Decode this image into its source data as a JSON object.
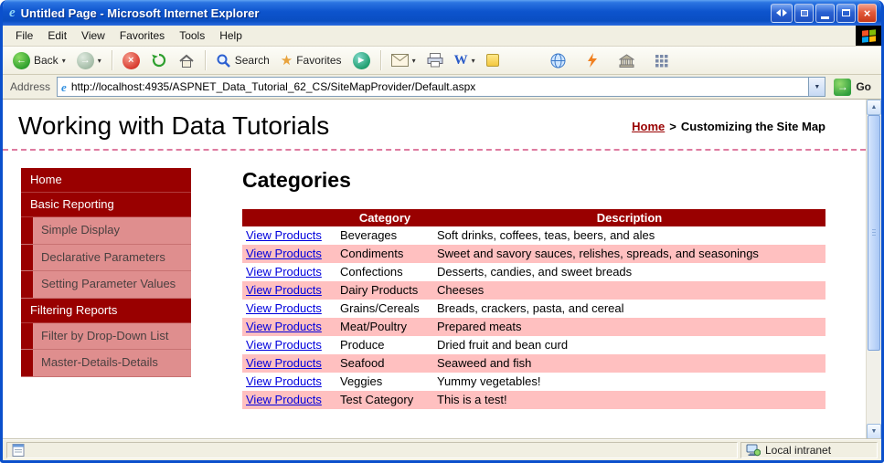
{
  "window": {
    "title": "Untitled Page - Microsoft Internet Explorer",
    "menu": [
      "File",
      "Edit",
      "View",
      "Favorites",
      "Tools",
      "Help"
    ],
    "toolbar": {
      "back": "Back",
      "search": "Search",
      "favorites": "Favorites"
    },
    "address": {
      "label": "Address",
      "url": "http://localhost:4935/ASPNET_Data_Tutorial_62_CS/SiteMapProvider/Default.aspx",
      "go": "Go"
    },
    "status": {
      "zone": "Local intranet"
    }
  },
  "page": {
    "header": {
      "title": "Working with Data Tutorials",
      "breadcrumb": {
        "home": "Home",
        "separator": ">",
        "current": "Customizing the Site Map"
      }
    },
    "sidebar": {
      "items": [
        {
          "label": "Home",
          "level": 1
        },
        {
          "label": "Basic Reporting",
          "level": 1
        },
        {
          "label": "Simple Display",
          "level": 2
        },
        {
          "label": "Declarative Parameters",
          "level": 2
        },
        {
          "label": "Setting Parameter Values",
          "level": 2
        },
        {
          "label": "Filtering Reports",
          "level": 1
        },
        {
          "label": "Filter by Drop-Down List",
          "level": 2
        },
        {
          "label": "Master-Details-Details",
          "level": 2
        }
      ]
    },
    "main": {
      "heading": "Categories",
      "table": {
        "headers": [
          "",
          "Category",
          "Description"
        ],
        "link_label": "View Products",
        "rows": [
          {
            "category": "Beverages",
            "description": "Soft drinks, coffees, teas, beers, and ales"
          },
          {
            "category": "Condiments",
            "description": "Sweet and savory sauces, relishes, spreads, and seasonings"
          },
          {
            "category": "Confections",
            "description": "Desserts, candies, and sweet breads"
          },
          {
            "category": "Dairy Products",
            "description": "Cheeses"
          },
          {
            "category": "Grains/Cereals",
            "description": "Breads, crackers, pasta, and cereal"
          },
          {
            "category": "Meat/Poultry",
            "description": "Prepared meats"
          },
          {
            "category": "Produce",
            "description": "Dried fruit and bean curd"
          },
          {
            "category": "Seafood",
            "description": "Seaweed and fish"
          },
          {
            "category": "Veggies",
            "description": "Yummy vegetables!"
          },
          {
            "category": "Test Category",
            "description": "This is a test!"
          }
        ]
      }
    }
  },
  "icons": {
    "e": "e",
    "close": "×",
    "caret": "▾",
    "dropdown": "▼",
    "star": "★",
    "play": "▶",
    "back_arrow": "←",
    "forward_arrow": "→",
    "stop_x": "×",
    "up": "▲",
    "down": "▼",
    "go_arrow": "→",
    "word": "W"
  },
  "colors": {
    "maroon": "#990000",
    "row_pink": "#ffc0c0",
    "sub_item_pink": "#df8e8e",
    "link_blue": "#0000dd",
    "titlebar_blue": "#0d54cd"
  }
}
